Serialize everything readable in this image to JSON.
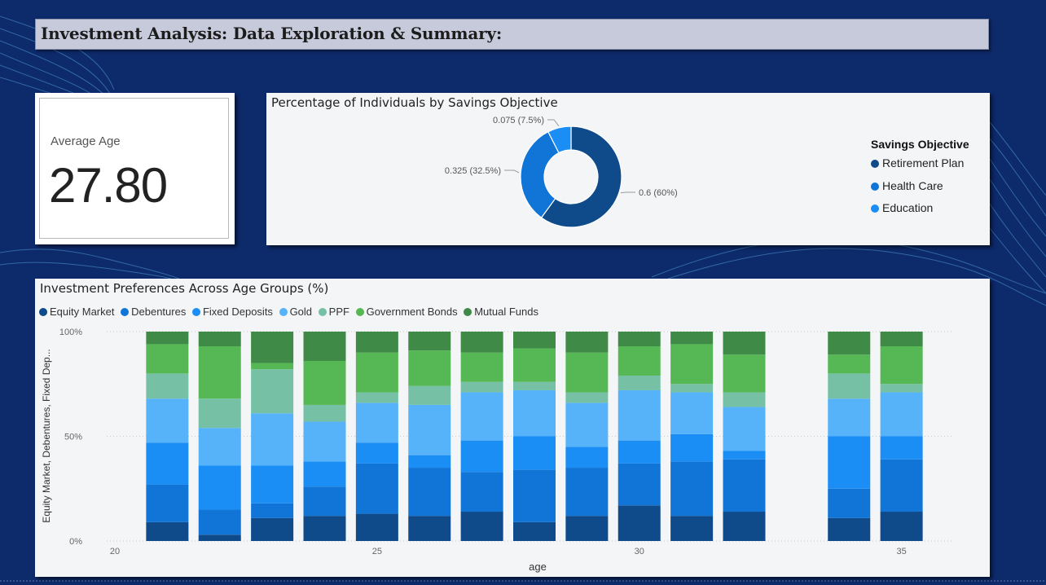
{
  "page": {
    "title": "Investment Analysis: Data Exploration & Summary:"
  },
  "kpi": {
    "label": "Average Age",
    "value": "27.80"
  },
  "donut": {
    "title": "Percentage of Individuals by Savings Objective",
    "legend_title": "Savings Objective",
    "slices": [
      {
        "name": "Retirement Plan",
        "value": 0.6,
        "label": "0.6 (60%)",
        "color": "#0f4a8a"
      },
      {
        "name": "Health Care",
        "value": 0.325,
        "label": "0.325 (32.5%)",
        "color": "#1175d8"
      },
      {
        "name": "Education",
        "value": 0.075,
        "label": "0.075 (7.5%)",
        "color": "#1a8ef5"
      }
    ]
  },
  "chart_data": {
    "type": "bar",
    "stacked": true,
    "title": "Investment Preferences Across Age Groups (%)",
    "xlabel": "age",
    "ylabel": "Equity Market, Debentures, Fixed Dep...",
    "x": [
      21,
      22,
      23,
      24,
      25,
      26,
      27,
      28,
      29,
      30,
      31,
      32,
      34,
      35
    ],
    "xlim": [
      20,
      36
    ],
    "x_ticks": [
      "20",
      "25",
      "30",
      "35"
    ],
    "y_ticks": [
      "0%",
      "50%",
      "100%"
    ],
    "ylim": [
      0,
      100
    ],
    "series": [
      {
        "name": "Equity Market",
        "color": "#0f4a8a",
        "values": [
          9,
          3,
          11,
          12,
          13,
          12,
          14,
          9,
          12,
          17,
          12,
          14,
          11,
          14
        ]
      },
      {
        "name": "Debentures",
        "color": "#1175d8",
        "values": [
          18,
          12,
          7,
          14,
          24,
          23,
          19,
          25,
          23,
          20,
          26,
          25,
          14,
          25
        ]
      },
      {
        "name": "Fixed Deposits",
        "color": "#1a8ef5",
        "values": [
          20,
          21,
          18,
          12,
          10,
          6,
          15,
          16,
          10,
          11,
          13,
          4,
          25,
          11
        ]
      },
      {
        "name": "Gold",
        "color": "#56b3fa",
        "values": [
          21,
          18,
          25,
          19,
          19,
          24,
          23,
          22,
          21,
          24,
          20,
          21,
          18,
          21
        ]
      },
      {
        "name": "PPF",
        "color": "#76c1a6",
        "values": [
          12,
          14,
          21,
          8,
          5,
          9,
          5,
          4,
          5,
          7,
          4,
          7,
          12,
          4
        ]
      },
      {
        "name": "Government Bonds",
        "color": "#56b854",
        "values": [
          14,
          25,
          3,
          21,
          19,
          17,
          14,
          16,
          19,
          14,
          19,
          18,
          9,
          18
        ]
      },
      {
        "name": "Mutual Funds",
        "color": "#3f8a47",
        "values": [
          6,
          7,
          15,
          14,
          10,
          9,
          10,
          8,
          10,
          7,
          6,
          11,
          11,
          7
        ]
      }
    ]
  }
}
